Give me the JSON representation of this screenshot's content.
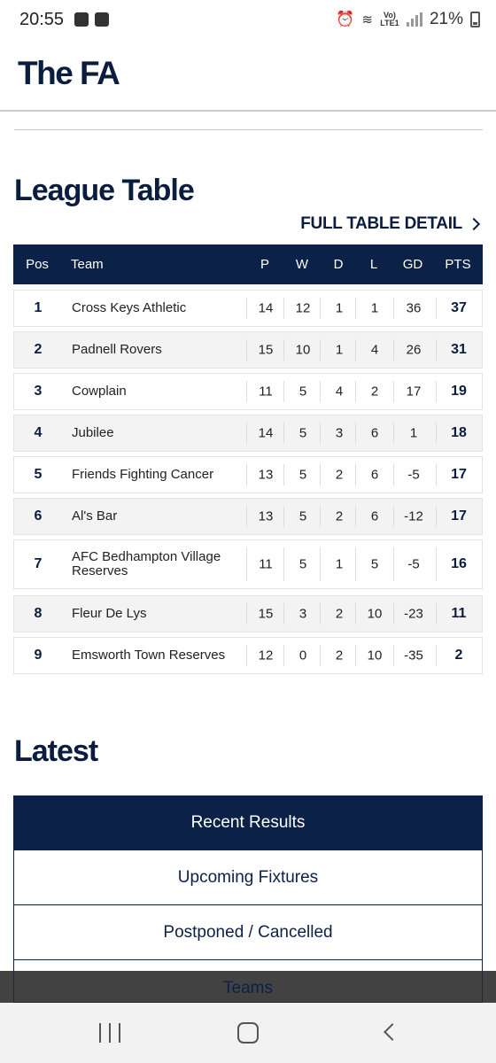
{
  "status_bar": {
    "time": "20:55",
    "network_label": "Vo) LTE1",
    "battery": "21%"
  },
  "header": {
    "logo_text": "The FA"
  },
  "league": {
    "title": "League Table",
    "full_table_link": "FULL TABLE DETAIL",
    "columns": {
      "pos": "Pos",
      "team": "Team",
      "p": "P",
      "w": "W",
      "d": "D",
      "l": "L",
      "gd": "GD",
      "pts": "PTS"
    },
    "rows": [
      {
        "pos": "1",
        "team": "Cross Keys Athletic",
        "p": "14",
        "w": "12",
        "d": "1",
        "l": "1",
        "gd": "36",
        "pts": "37"
      },
      {
        "pos": "2",
        "team": "Padnell Rovers",
        "p": "15",
        "w": "10",
        "d": "1",
        "l": "4",
        "gd": "26",
        "pts": "31"
      },
      {
        "pos": "3",
        "team": "Cowplain",
        "p": "11",
        "w": "5",
        "d": "4",
        "l": "2",
        "gd": "17",
        "pts": "19"
      },
      {
        "pos": "4",
        "team": "Jubilee",
        "p": "14",
        "w": "5",
        "d": "3",
        "l": "6",
        "gd": "1",
        "pts": "18"
      },
      {
        "pos": "5",
        "team": "Friends Fighting Cancer",
        "p": "13",
        "w": "5",
        "d": "2",
        "l": "6",
        "gd": "-5",
        "pts": "17"
      },
      {
        "pos": "6",
        "team": "Al's Bar",
        "p": "13",
        "w": "5",
        "d": "2",
        "l": "6",
        "gd": "-12",
        "pts": "17"
      },
      {
        "pos": "7",
        "team": "AFC Bedhampton Village Reserves",
        "p": "11",
        "w": "5",
        "d": "1",
        "l": "5",
        "gd": "-5",
        "pts": "16"
      },
      {
        "pos": "8",
        "team": "Fleur De Lys",
        "p": "15",
        "w": "3",
        "d": "2",
        "l": "10",
        "gd": "-23",
        "pts": "11"
      },
      {
        "pos": "9",
        "team": "Emsworth Town Reserves",
        "p": "12",
        "w": "0",
        "d": "2",
        "l": "10",
        "gd": "-35",
        "pts": "2"
      }
    ]
  },
  "latest": {
    "title": "Latest",
    "tabs": [
      {
        "label": "Recent Results",
        "active": true
      },
      {
        "label": "Upcoming Fixtures",
        "active": false
      },
      {
        "label": "Postponed / Cancelled",
        "active": false
      }
    ],
    "overlay_tab_label": "Teams"
  },
  "colors": {
    "navy": "#0c2147",
    "row_alt": "#f3f3f3"
  }
}
